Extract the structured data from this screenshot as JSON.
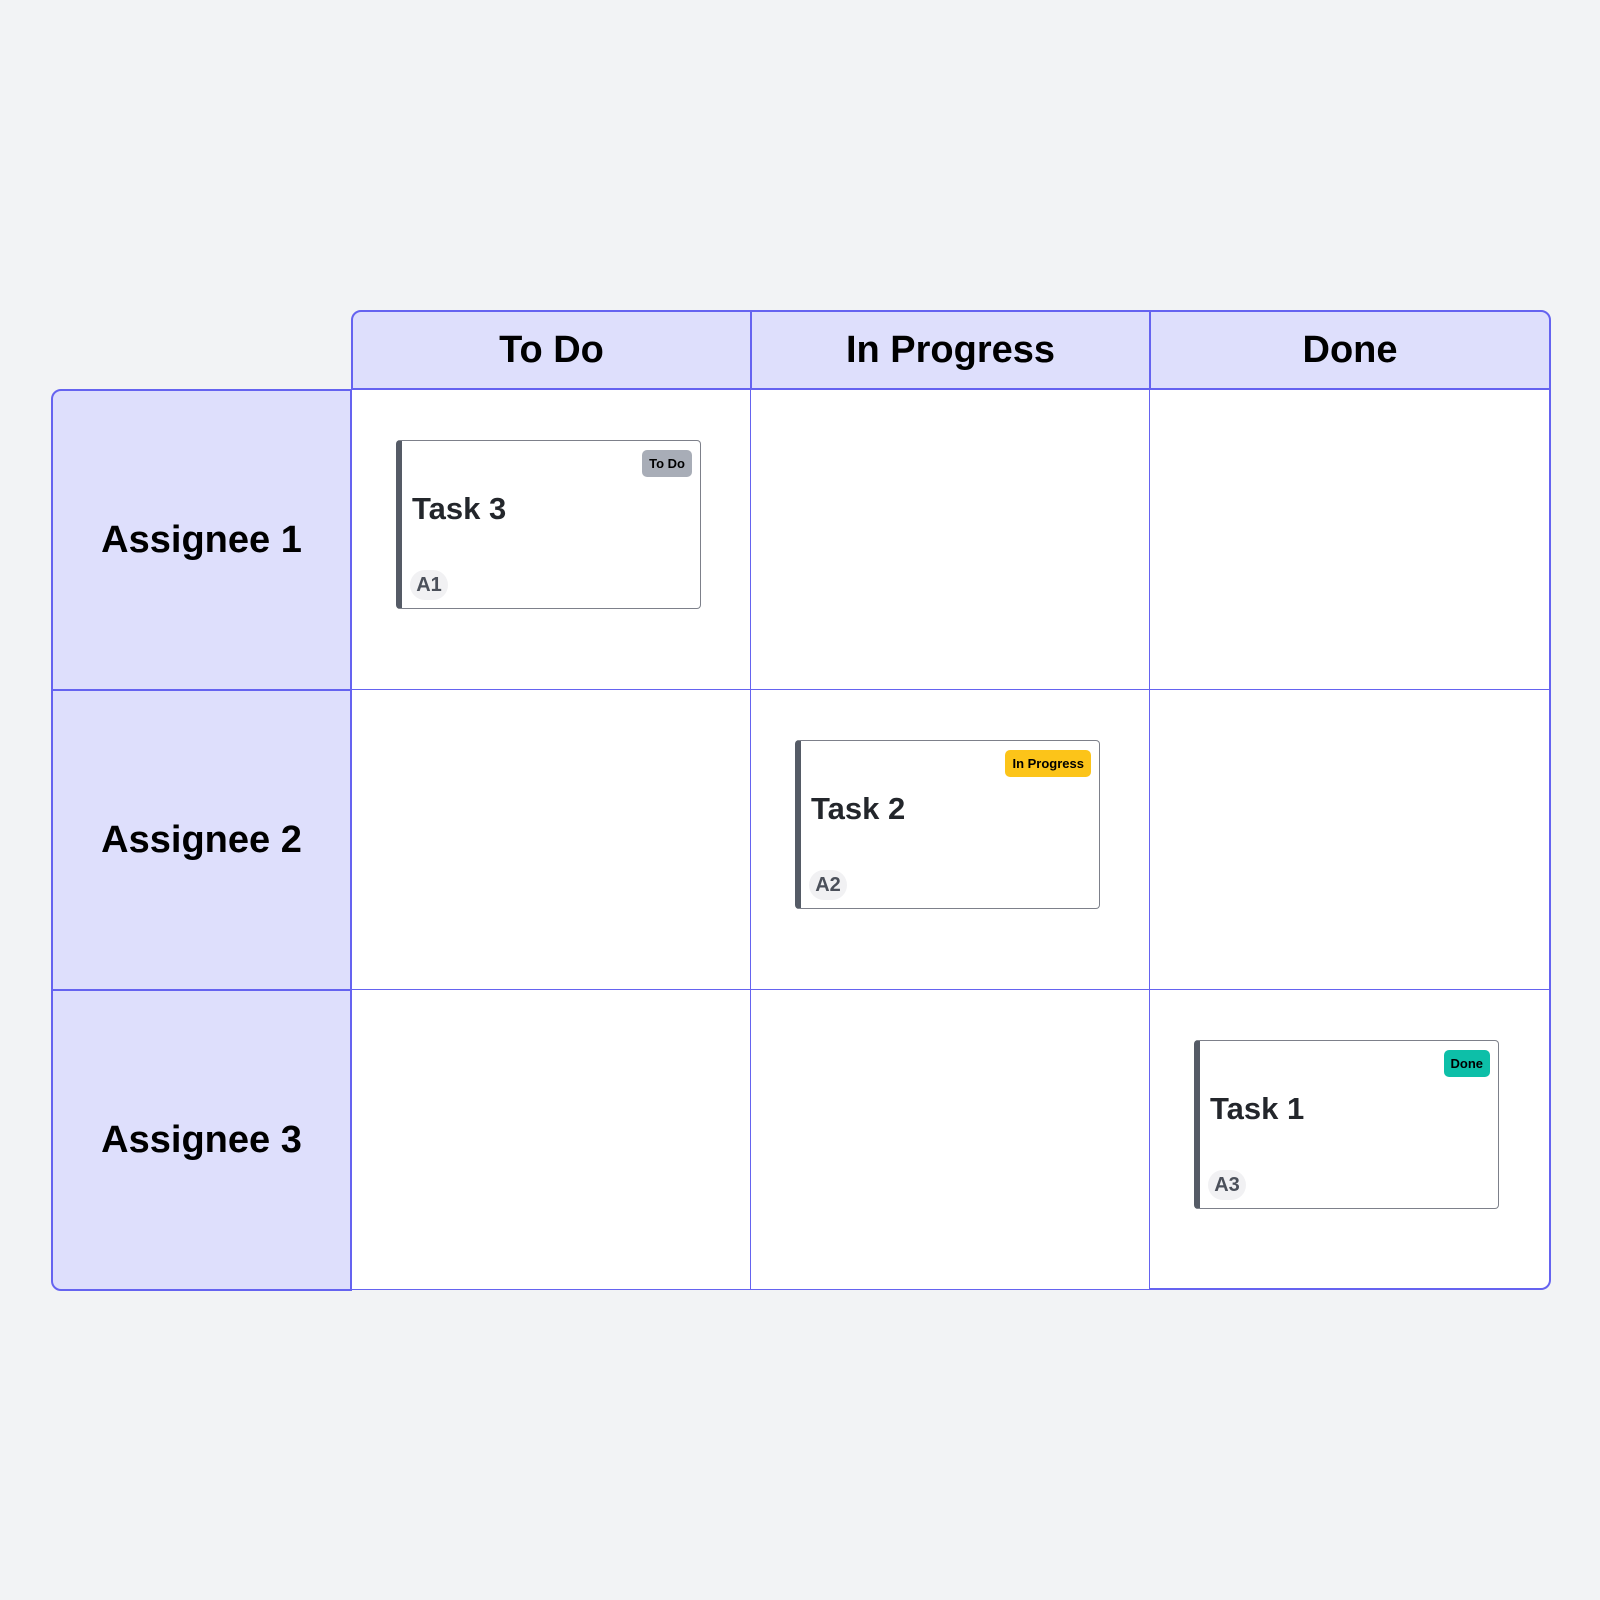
{
  "columns": [
    "To Do",
    "In Progress",
    "Done"
  ],
  "rows": [
    "Assignee 1",
    "Assignee 2",
    "Assignee 3"
  ],
  "tasks": [
    {
      "title": "Task 3",
      "status": "To Do",
      "assignee": "A1",
      "color": "#a8adb7"
    },
    {
      "title": "Task 2",
      "status": "In Progress",
      "assignee": "A2",
      "color": "#fcc419"
    },
    {
      "title": "Task 1",
      "status": "Done",
      "assignee": "A3",
      "color": "#0dbfa8"
    }
  ],
  "colors": {
    "border": "#6563f0",
    "header_bg": "#dedffc"
  }
}
